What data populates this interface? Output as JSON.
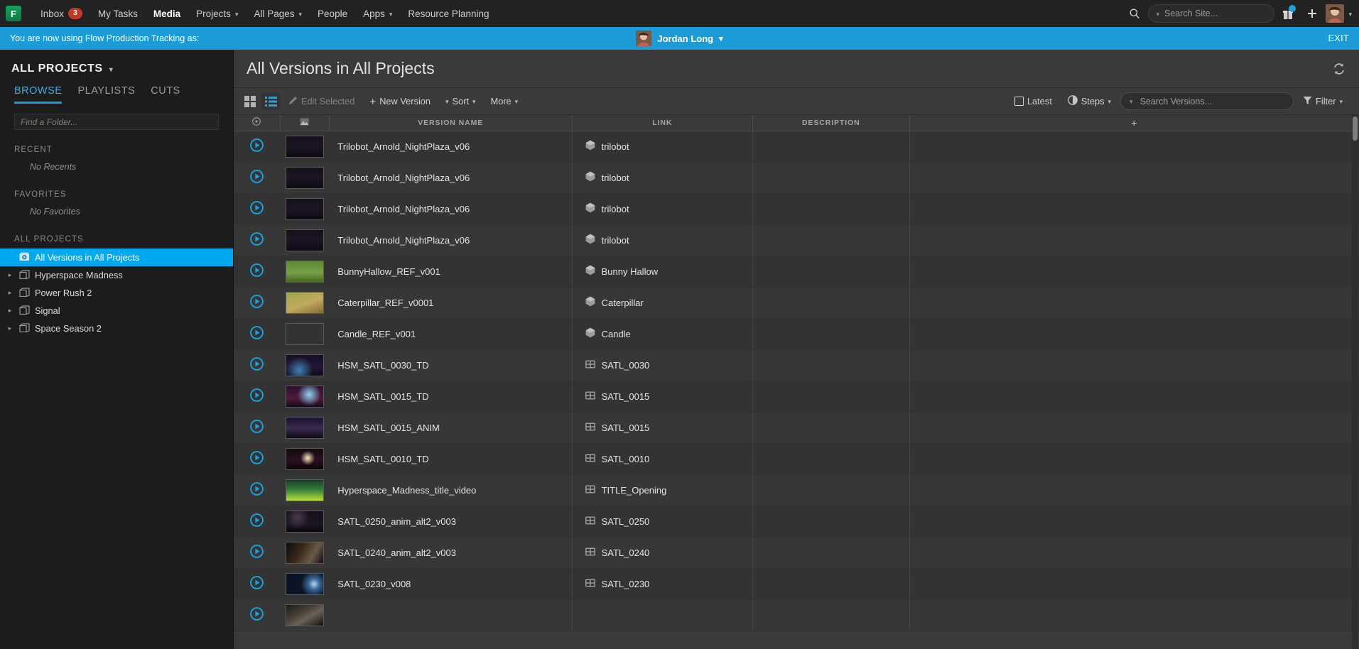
{
  "topnav": {
    "logo_letter": "F",
    "items": [
      {
        "label": "Inbox",
        "badge": "3",
        "icon": "",
        "active": false,
        "caret": false
      },
      {
        "label": "My Tasks",
        "active": false,
        "caret": false
      },
      {
        "label": "Media",
        "active": true,
        "caret": false
      },
      {
        "label": "Projects",
        "active": false,
        "caret": true
      },
      {
        "label": "All Pages",
        "active": false,
        "caret": true
      },
      {
        "label": "People",
        "active": false,
        "caret": false
      },
      {
        "label": "Apps",
        "active": false,
        "caret": true
      },
      {
        "label": "Resource Planning",
        "active": false,
        "caret": false
      }
    ],
    "search_placeholder": "Search Site...",
    "icons": [
      "search-icon",
      "chevron-down-icon",
      "gift-icon",
      "plus-icon",
      "avatar",
      "chevron-down-icon"
    ]
  },
  "banner": {
    "message": "You are now using Flow Production Tracking as:",
    "user": "Jordan Long",
    "caret": "▾",
    "exit_label": "EXIT",
    "color": "#1b9cd8"
  },
  "sidebar": {
    "title": "ALL PROJECTS",
    "tabs": [
      {
        "label": "BROWSE",
        "active": true
      },
      {
        "label": "PLAYLISTS",
        "active": false
      },
      {
        "label": "CUTS",
        "active": false
      }
    ],
    "find_placeholder": "Find a Folder...",
    "sections": [
      {
        "label": "RECENT",
        "empty": "No Recents",
        "items": []
      },
      {
        "label": "FAVORITES",
        "empty": "No Favorites",
        "items": []
      },
      {
        "label": "ALL PROJECTS",
        "empty": "",
        "items": [
          {
            "label": "All Versions in All Projects",
            "icon": "media-folder-icon",
            "selected": true,
            "expandable": false
          },
          {
            "label": "Hyperspace Madness",
            "icon": "project-folder-icon",
            "selected": false,
            "expandable": true
          },
          {
            "label": "Power Rush 2",
            "icon": "project-folder-icon",
            "selected": false,
            "expandable": true
          },
          {
            "label": "Signal",
            "icon": "project-folder-icon",
            "selected": false,
            "expandable": true
          },
          {
            "label": "Space Season 2",
            "icon": "project-folder-icon",
            "selected": false,
            "expandable": true
          }
        ]
      }
    ],
    "selected_color": "#00a9f0"
  },
  "page": {
    "title": "All Versions in All Projects",
    "refresh_icon": "refresh-icon"
  },
  "toolbar": {
    "grid_view_icon": "grid-view-icon",
    "list_view_icon": "list-view-icon",
    "list_view_active": true,
    "edit_selected_label": "Edit Selected",
    "edit_selected_disabled": true,
    "new_version_label": "New Version",
    "sort_label": "Sort",
    "more_label": "More",
    "latest_label": "Latest",
    "latest_checked": false,
    "steps_label": "Steps",
    "search_placeholder": "Search Versions...",
    "filter_label": "Filter"
  },
  "table": {
    "columns": [
      {
        "label": "",
        "name": "play-column",
        "icon": "play-circle-icon"
      },
      {
        "label": "",
        "name": "thumbnail-column",
        "icon": "image-icon"
      },
      {
        "label": "VERSION NAME",
        "name": "version-name-column"
      },
      {
        "label": "LINK",
        "name": "link-column"
      },
      {
        "label": "DESCRIPTION",
        "name": "description-column"
      },
      {
        "label": "+",
        "name": "add-column"
      }
    ],
    "rows": [
      {
        "version_name": "Trilobot_Arnold_NightPlaza_v06",
        "link": "trilobot",
        "link_type": "asset",
        "description": "",
        "thumb": "night-plaza-purple"
      },
      {
        "version_name": "Trilobot_Arnold_NightPlaza_v06",
        "link": "trilobot",
        "link_type": "asset",
        "description": "",
        "thumb": "night-plaza-purple"
      },
      {
        "version_name": "Trilobot_Arnold_NightPlaza_v06",
        "link": "trilobot",
        "link_type": "asset",
        "description": "",
        "thumb": "night-plaza-purple"
      },
      {
        "version_name": "Trilobot_Arnold_NightPlaza_v06",
        "link": "trilobot",
        "link_type": "asset",
        "description": "",
        "thumb": "night-plaza-purple"
      },
      {
        "version_name": "BunnyHallow_REF_v001",
        "link": "Bunny Hallow",
        "link_type": "asset",
        "description": "",
        "thumb": "bunny-grass"
      },
      {
        "version_name": "Caterpillar_REF_v0001",
        "link": "Caterpillar",
        "link_type": "asset",
        "description": "",
        "thumb": "caterpillar-leaf"
      },
      {
        "version_name": "Candle_REF_v001",
        "link": "Candle",
        "link_type": "asset",
        "description": "",
        "thumb": "candle-dark"
      },
      {
        "version_name": "HSM_SATL_0030_TD",
        "link": "SATL_0030",
        "link_type": "shot",
        "description": "",
        "thumb": "planet-space"
      },
      {
        "version_name": "HSM_SATL_0015_TD",
        "link": "SATL_0015",
        "link_type": "shot",
        "description": "",
        "thumb": "character-blue"
      },
      {
        "version_name": "HSM_SATL_0015_ANIM",
        "link": "SATL_0015",
        "link_type": "shot",
        "description": "",
        "thumb": "character-stars"
      },
      {
        "version_name": "HSM_SATL_0010_TD",
        "link": "SATL_0010",
        "link_type": "shot",
        "description": "",
        "thumb": "light-streak"
      },
      {
        "version_name": "Hyperspace_Madness_title_video",
        "link": "TITLE_Opening",
        "link_type": "shot",
        "description": "",
        "thumb": "title-card-green"
      },
      {
        "version_name": "SATL_0250_anim_alt2_v003",
        "link": "SATL_0250",
        "link_type": "shot",
        "description": "",
        "thumb": "starfield-dark"
      },
      {
        "version_name": "SATL_0240_anim_alt2_v003",
        "link": "SATL_0240",
        "link_type": "shot",
        "description": "",
        "thumb": "cockpit-dark"
      },
      {
        "version_name": "SATL_0230_v008",
        "link": "SATL_0230",
        "link_type": "shot",
        "description": "",
        "thumb": "planet-limb"
      },
      {
        "version_name": "",
        "link": "",
        "link_type": "shot",
        "description": "",
        "thumb": "debris-dark"
      }
    ]
  }
}
